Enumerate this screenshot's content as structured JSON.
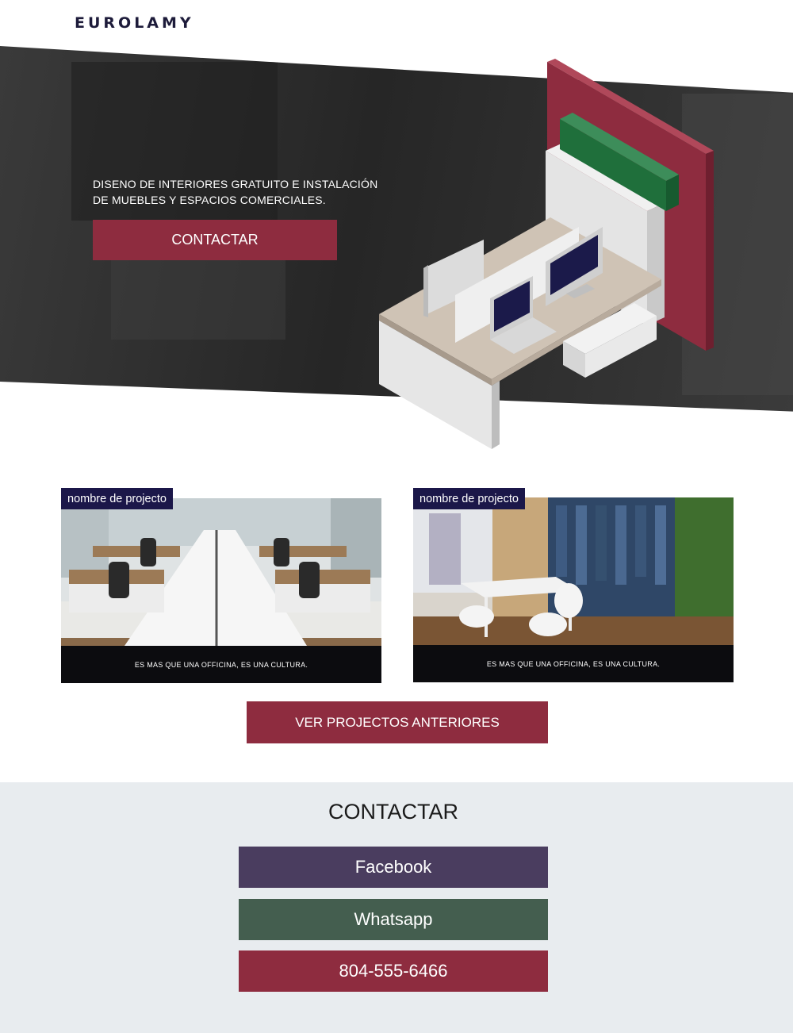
{
  "brand": {
    "logo_text": "EUROLAMY"
  },
  "hero": {
    "line1": "DISENO DE INTERIORES GRATUITO E INSTALACIÓN",
    "line2": "DE MUEBLES Y ESPACIOS COMERCIALES.",
    "cta_label": "CONTACTAR",
    "accent_color": "#8e2c3f"
  },
  "projects": [
    {
      "tag": "nombre de projecto",
      "caption": "ES MAS QUE UNA OFFICINA, ES UNA CULTURA."
    },
    {
      "tag": "nombre de projecto",
      "caption": "ES MAS QUE UNA OFFICINA, ES UNA CULTURA."
    }
  ],
  "more_projects_label": "VER PROJECTOS ANTERIORES",
  "contact": {
    "title": "CONTACTAR",
    "buttons": [
      {
        "label": "Facebook",
        "color": "#4a3d5f"
      },
      {
        "label": "Whatsapp",
        "color": "#445e4f"
      },
      {
        "label": "804-555-6466",
        "color": "#8e2c3f"
      }
    ]
  }
}
